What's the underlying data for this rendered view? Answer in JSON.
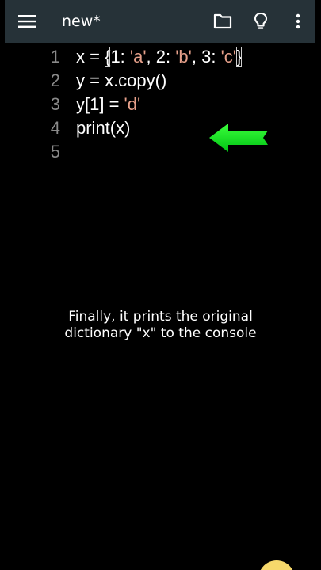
{
  "toolbar": {
    "title": "new*",
    "background": "#263238",
    "icons": {
      "menu": "menu-icon",
      "folder": "folder-icon",
      "bulb": "lightbulb-icon",
      "more": "more-vert-icon"
    }
  },
  "editor": {
    "lines": [
      {
        "number": "1",
        "segments": [
          "x = ",
          "{",
          "1: ",
          "'a'",
          ", 2: ",
          "'b'",
          ", 3: ",
          "'c'",
          "}"
        ]
      },
      {
        "number": "2",
        "text": "y = x.copy()"
      },
      {
        "number": "3",
        "segments": [
          "y[1] = ",
          "'d'"
        ]
      },
      {
        "number": "4",
        "text": "print(x)"
      },
      {
        "number": "5",
        "text": ""
      }
    ],
    "string_color": "#e6a08a",
    "text_color": "#ffffff",
    "line_number_color": "#8a8a8a"
  },
  "annotation": {
    "arrow_color": "#00e01a",
    "arrow_direction": "left"
  },
  "caption": {
    "line1": "Finally, it prints the original",
    "line2": "dictionary \"x\" to the console"
  }
}
